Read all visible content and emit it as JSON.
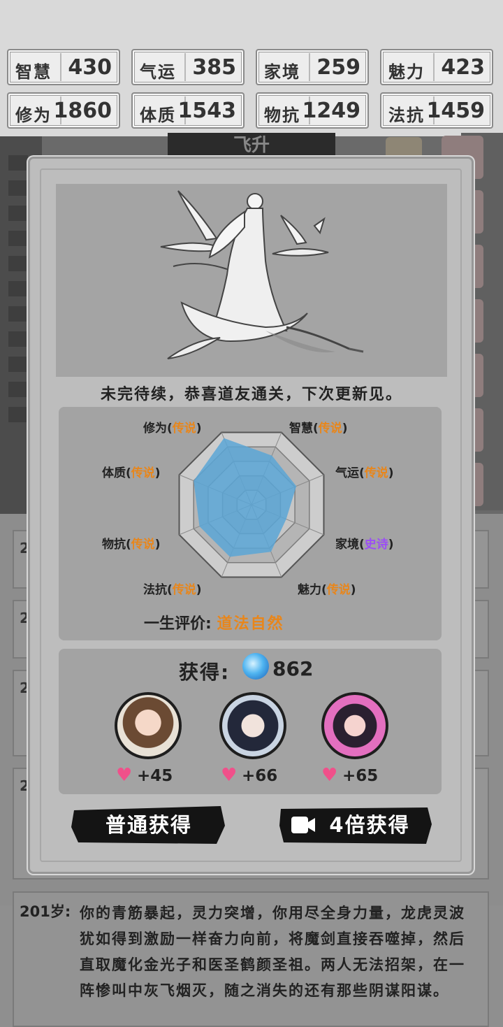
{
  "stats": [
    {
      "label": "智慧",
      "value": "430"
    },
    {
      "label": "气运",
      "value": "385"
    },
    {
      "label": "家境",
      "value": "259"
    },
    {
      "label": "魅力",
      "value": "423"
    },
    {
      "label": "修为",
      "value": "1860"
    },
    {
      "label": "体质",
      "value": "1543"
    },
    {
      "label": "物抗",
      "value": "1249"
    },
    {
      "label": "法抗",
      "value": "1459"
    }
  ],
  "background": {
    "feature_title": "飞升",
    "card_ages": [
      "2",
      "2",
      "2",
      "2"
    ]
  },
  "dialog": {
    "message": "未完待续，恭喜道友通关，下次更新见。",
    "radar": {
      "axes": [
        {
          "name": "智慧",
          "rating": "传说",
          "level": 0.68
        },
        {
          "name": "气运",
          "rating": "传说",
          "level": 0.62
        },
        {
          "name": "家境",
          "rating": "史诗",
          "level": 0.48
        },
        {
          "name": "魅力",
          "rating": "传说",
          "level": 0.65
        },
        {
          "name": "法抗",
          "rating": "传说",
          "level": 0.72
        },
        {
          "name": "物抗",
          "rating": "传说",
          "level": 0.72
        },
        {
          "name": "体质",
          "rating": "传说",
          "level": 0.8
        },
        {
          "name": "修为",
          "rating": "传说",
          "level": 0.92
        }
      ],
      "colors": {
        "legend": "#e8861b",
        "epic": "#9b4ef5",
        "fill": "#5aa6d6"
      }
    },
    "evaluation": {
      "label": "一生评价:",
      "value": "道法自然"
    },
    "reward": {
      "label": "获得:",
      "amount": "862",
      "characters": [
        {
          "bonus": "+45"
        },
        {
          "bonus": "+66"
        },
        {
          "bonus": "+65"
        }
      ]
    },
    "buttons": {
      "normal": "普通获得",
      "video": "4倍获得"
    }
  },
  "log": {
    "age": "201岁:",
    "text": "你的青筋暴起，灵力突增，你用尽全身力量，龙虎灵波犹如得到激励一样奋力向前，将魔剑直接吞噬掉，然后直取魔化金光子和医圣鹤颜圣祖。两人无法招架，在一阵惨叫中灰飞烟灭，随之消失的还有那些阴谋阳谋。"
  }
}
